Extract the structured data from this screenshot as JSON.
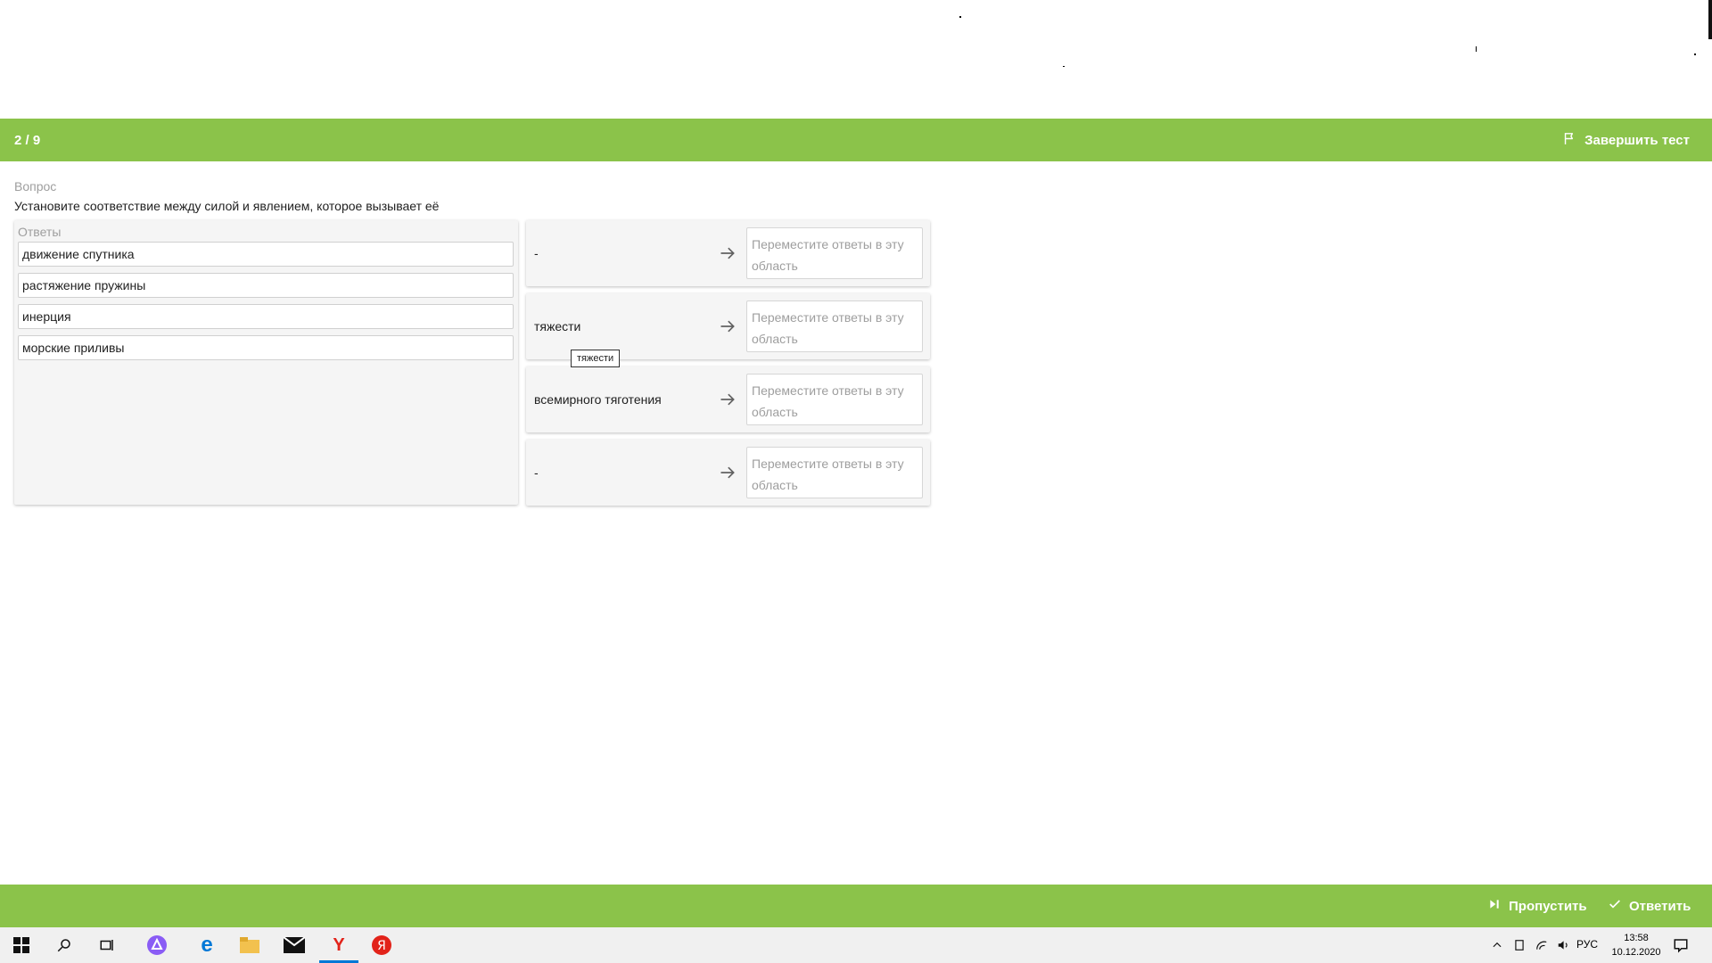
{
  "header": {
    "counter": "2 / 9",
    "finish_label": "Завершить тест"
  },
  "question": {
    "label": "Вопрос",
    "text": "Установите соответствие между силой и явлением, которое вызывает её"
  },
  "answers": {
    "label": "Ответы",
    "items": [
      "движение спутника",
      "растяжение пружины",
      "инерция",
      "морские приливы"
    ]
  },
  "matches": [
    {
      "label": "-",
      "drop_placeholder": "Переместите ответы в эту область"
    },
    {
      "label": "тяжести",
      "drop_placeholder": "Переместите ответы в эту область"
    },
    {
      "label": "всемирного тяготения",
      "drop_placeholder": "Переместите ответы в эту область"
    },
    {
      "label": "-",
      "drop_placeholder": "Переместите ответы в эту область"
    }
  ],
  "tooltip": "тяжести",
  "footer": {
    "skip_label": "Пропустить",
    "answer_label": "Ответить"
  },
  "taskbar": {
    "icons": [
      "windows-start-icon",
      "search-icon",
      "task-view-icon",
      "alice-icon",
      "edge-icon",
      "file-explorer-icon",
      "mail-icon",
      "yandex-browser-icon",
      "yandex-icon"
    ],
    "active_icon": "yandex-browser-icon",
    "language": "РУС",
    "time": "13:58",
    "date": "10.12.2020"
  },
  "colors": {
    "accent": "#8bc34a",
    "panel": "#f5f5f5"
  }
}
